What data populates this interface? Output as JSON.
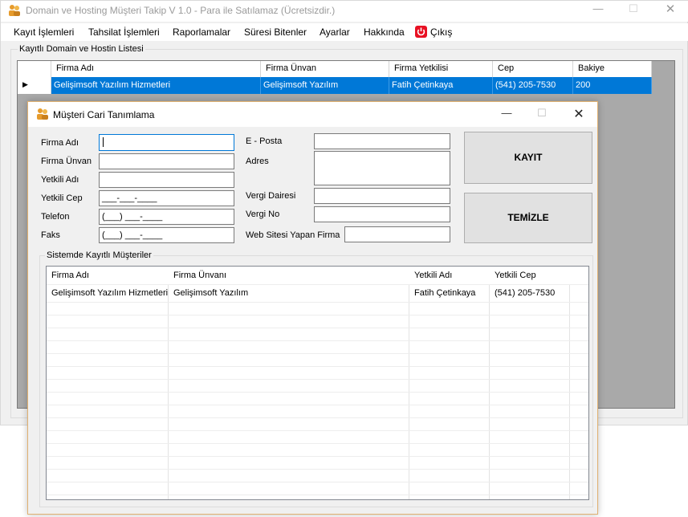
{
  "main": {
    "title": "Domain ve Hosting Müşteri Takip V 1.0 - Para ile Satılamaz (Ücretsizdir.)",
    "menu": [
      "Kayıt İşlemleri",
      "Tahsilat İşlemleri",
      "Raporlamalar",
      "Süresi Bitenler",
      "Ayarlar",
      "Hakkında",
      "Çıkış"
    ],
    "group_title": "Kayıtlı Domain ve Hostin Listesi",
    "grid": {
      "columns": [
        "Firma Adı",
        "Firma Ünvan",
        "Firma Yetkilisi",
        "Cep",
        "Bakiye"
      ],
      "rows": [
        [
          "Gelişimsoft Yazılım Hizmetleri",
          "Gelişimsoft Yazılım",
          "Fatih Çetinkaya",
          "(541) 205-7530",
          "200"
        ]
      ]
    }
  },
  "dialog": {
    "title": "Müşteri Cari Tanımlama",
    "labels": {
      "firma_adi": "Firma Adı",
      "firma_unvan": "Firma Ünvan",
      "yetkili_adi": "Yetkili Adı",
      "yetkili_cep": "Yetkili Cep",
      "telefon": "Telefon",
      "faks": "Faks",
      "eposta": "E - Posta",
      "adres": "Adres",
      "vergi_dairesi": "Vergi Dairesi",
      "vergi_no": "Vergi No",
      "web_firma": "Web Sitesi Yapan Firma"
    },
    "masks": {
      "yetkili_cep": "___-___-____",
      "telefon": "(___) ___-____",
      "faks": "(___) ___-____"
    },
    "buttons": {
      "kayit": "KAYIT",
      "temizle": "TEMİZLE"
    },
    "group_title": "Sistemde Kayıtlı Müşteriler",
    "grid": {
      "columns": [
        "Firma Adı",
        "Firma Ünvanı",
        "Yetkili Adı",
        "Yetkili Cep"
      ],
      "rows": [
        [
          "Gelişimsoft Yazılım Hizmetleri",
          "Gelişimsoft Yazılım",
          "Fatih Çetinkaya",
          "(541) 205-7530"
        ]
      ]
    }
  },
  "colors": {
    "selection": "#0078d7",
    "close_icon_red": "#e81123",
    "app_icon_orange": "#e69b2c"
  }
}
